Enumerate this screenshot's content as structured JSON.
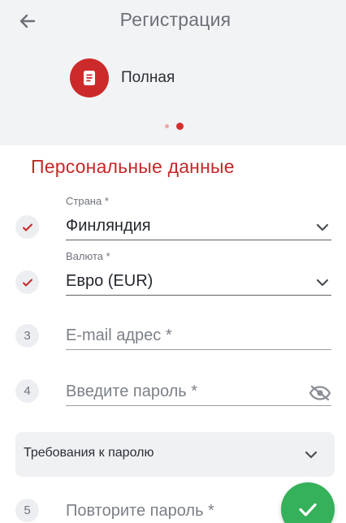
{
  "header": {
    "title": "Регистрация",
    "back_icon": "arrow-left-icon",
    "registration_type": {
      "label": "Полная",
      "icon": "document-icon",
      "color": "#cc2a2a"
    },
    "pager": {
      "total": 2,
      "active": 2
    }
  },
  "section": {
    "title": "Персональные данные",
    "color": "#c62828"
  },
  "form": {
    "country": {
      "caption": "Страна *",
      "value": "Финляндия",
      "status": "done"
    },
    "currency": {
      "caption": "Валюта *",
      "value": "Евро (EUR)",
      "status": "done"
    },
    "email": {
      "step": "3",
      "placeholder": "E-mail адрес *"
    },
    "password": {
      "step": "4",
      "placeholder": "Введите пароль *",
      "toggle_icon": "eye-off-icon"
    },
    "password_requirements": {
      "label": "Требования к паролю",
      "icon": "chevron-down-icon"
    },
    "repeat_password": {
      "step": "5",
      "placeholder": "Повторите пароль *"
    }
  },
  "fab": {
    "icon": "check-icon",
    "color": "#34b15a"
  }
}
